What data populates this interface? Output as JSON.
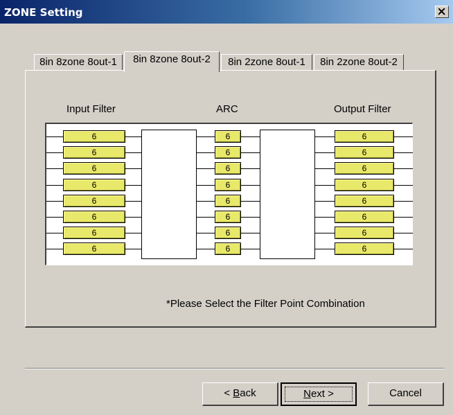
{
  "window": {
    "title": "ZONE Setting"
  },
  "tabs": [
    {
      "label": "8in 8zone 8out-1",
      "active": false
    },
    {
      "label": "8in 8zone 8out-2",
      "active": true
    },
    {
      "label": "8in 2zone 8out-1",
      "active": false
    },
    {
      "label": "8in 2zone 8out-2",
      "active": false
    }
  ],
  "headers": {
    "input_filter": "Input Filter",
    "arc": "ARC",
    "output_filter": "Output Filter"
  },
  "input_filters": [
    "6",
    "6",
    "6",
    "6",
    "6",
    "6",
    "6",
    "6"
  ],
  "arc_values": [
    "6",
    "6",
    "6",
    "6",
    "6",
    "6",
    "6",
    "6"
  ],
  "output_filters": [
    "6",
    "6",
    "6",
    "6",
    "6",
    "6",
    "6",
    "6"
  ],
  "note": "*Please Select the Filter Point Combination",
  "buttons": {
    "back_pre": "< ",
    "back_u": "B",
    "back_post": "ack",
    "next_u": "N",
    "next_post": "ext >",
    "cancel": "Cancel"
  },
  "colors": {
    "filter_button": "#e8e86a",
    "titlebar": "#0a246a"
  }
}
